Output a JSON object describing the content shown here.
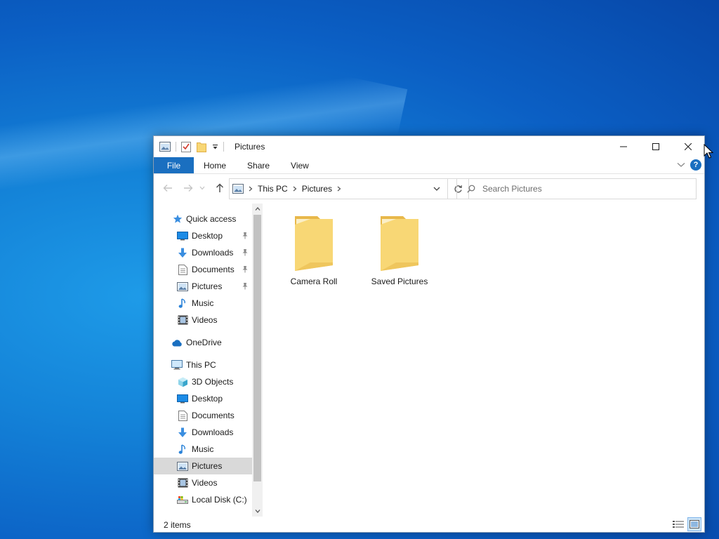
{
  "window": {
    "title": "Pictures",
    "controls": {
      "minimize": "minimize",
      "maximize": "maximize",
      "close": "close"
    }
  },
  "ribbon": {
    "file": "File",
    "tabs": [
      "Home",
      "Share",
      "View"
    ]
  },
  "address": {
    "crumbs": [
      "This PC",
      "Pictures"
    ]
  },
  "search": {
    "placeholder": "Search Pictures"
  },
  "navpane": {
    "items": [
      {
        "label": "Quick access",
        "icon": "star-icon",
        "pinned": false
      },
      {
        "label": "Desktop",
        "icon": "desktop-icon",
        "pinned": true
      },
      {
        "label": "Downloads",
        "icon": "download-icon",
        "pinned": true
      },
      {
        "label": "Documents",
        "icon": "document-icon",
        "pinned": true
      },
      {
        "label": "Pictures",
        "icon": "pictures-icon",
        "pinned": true
      },
      {
        "label": "Music",
        "icon": "music-icon",
        "pinned": false
      },
      {
        "label": "Videos",
        "icon": "video-icon",
        "pinned": false
      },
      {
        "label": "OneDrive",
        "icon": "cloud-icon",
        "pinned": false
      },
      {
        "label": "This PC",
        "icon": "computer-icon",
        "pinned": false
      },
      {
        "label": "3D Objects",
        "icon": "cube-icon",
        "pinned": false
      },
      {
        "label": "Desktop",
        "icon": "desktop-icon",
        "pinned": false
      },
      {
        "label": "Documents",
        "icon": "document-icon",
        "pinned": false
      },
      {
        "label": "Downloads",
        "icon": "download-icon",
        "pinned": false
      },
      {
        "label": "Music",
        "icon": "music-icon",
        "pinned": false
      },
      {
        "label": "Pictures",
        "icon": "pictures-icon",
        "pinned": false,
        "selected": true
      },
      {
        "label": "Videos",
        "icon": "video-icon",
        "pinned": false
      },
      {
        "label": "Local Disk (C:)",
        "icon": "drive-icon",
        "pinned": false
      }
    ]
  },
  "content": {
    "items": [
      {
        "label": "Camera Roll",
        "icon": "folder-icon"
      },
      {
        "label": "Saved Pictures",
        "icon": "folder-icon"
      }
    ]
  },
  "status": {
    "count": "2 items"
  },
  "colors": {
    "accent": "#1a6fc0",
    "folder": "#f8d775",
    "folder_dark": "#e8b84a",
    "selection": "#d9d9d9"
  }
}
